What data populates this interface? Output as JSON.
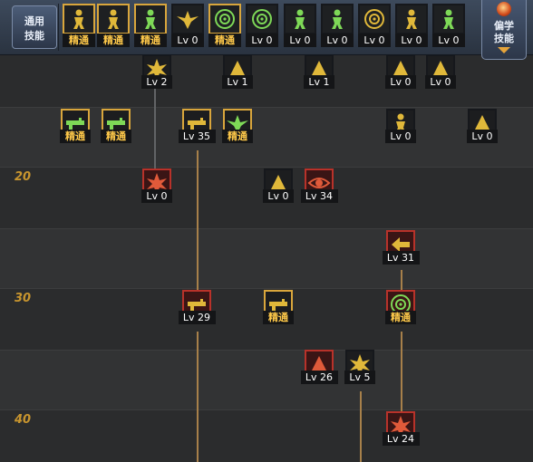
{
  "top_bar": {
    "common_tab": {
      "line1": "通用",
      "line2": "技能"
    },
    "side_tab": {
      "line1": "偏学",
      "line2": "技能"
    },
    "skills": [
      {
        "label": "精通",
        "mastered": true,
        "icon": "sitting-figure-icon",
        "color": "#e0b83a"
      },
      {
        "label": "精通",
        "mastered": true,
        "icon": "crouching-figure-icon",
        "color": "#e0b83a"
      },
      {
        "label": "精通",
        "mastered": true,
        "icon": "running-figure-icon",
        "color": "#7ed957"
      },
      {
        "label": "Lv 0",
        "mastered": false,
        "icon": "winged-emblem-icon",
        "color": "#e0b83a"
      },
      {
        "label": "精通",
        "mastered": true,
        "icon": "crosshair-target-icon",
        "color": "#7ed957"
      },
      {
        "label": "Lv 0",
        "mastered": false,
        "icon": "crosshair-target-icon",
        "color": "#7ed957"
      },
      {
        "label": "Lv 0",
        "mastered": false,
        "icon": "soldier-bust-icon",
        "color": "#7ed957"
      },
      {
        "label": "Lv 0",
        "mastered": false,
        "icon": "soldier-bust-icon",
        "color": "#7ed957"
      },
      {
        "label": "Lv 0",
        "mastered": false,
        "icon": "concentric-rings-icon",
        "color": "#e0b83a"
      },
      {
        "label": "Lv 0",
        "mastered": false,
        "icon": "muscle-figure-icon",
        "color": "#e0b83a"
      },
      {
        "label": "Lv 0",
        "mastered": false,
        "icon": "standing-figure-icon",
        "color": "#7ed957"
      }
    ]
  },
  "level_labels": [
    "20",
    "30",
    "40"
  ],
  "tree": [
    {
      "label": "Lv 2",
      "mastered": false,
      "frame": "dark",
      "icon": "fire-burst-icon",
      "color": "#e0b83a"
    },
    {
      "label": "Lv 1",
      "mastered": false,
      "frame": "dark",
      "icon": "flag-icon",
      "color": "#e0b83a"
    },
    {
      "label": "Lv 1",
      "mastered": false,
      "frame": "dark",
      "icon": "lightning-icon",
      "color": "#e0b83a"
    },
    {
      "label": "Lv 0",
      "mastered": false,
      "frame": "dark",
      "icon": "treasure-box-icon",
      "color": "#e0b83a"
    },
    {
      "label": "Lv 0",
      "mastered": false,
      "frame": "dark",
      "icon": "trophy-icon",
      "color": "#e0b83a"
    },
    {
      "label": "精通",
      "mastered": true,
      "frame": "gold",
      "icon": "rifle-icon",
      "color": "#7ed957"
    },
    {
      "label": "精通",
      "mastered": true,
      "frame": "gold",
      "icon": "rifle-icon",
      "color": "#7ed957"
    },
    {
      "label": "Lv 35",
      "mastered": false,
      "frame": "gold",
      "icon": "heavy-gun-icon",
      "color": "#e0b83a"
    },
    {
      "label": "精通",
      "mastered": true,
      "frame": "gold",
      "icon": "jet-fighter-icon",
      "color": "#7ed957"
    },
    {
      "label": "Lv 0",
      "mastered": false,
      "frame": "dark",
      "icon": "leaping-figure-icon",
      "color": "#e0b83a"
    },
    {
      "label": "Lv 0",
      "mastered": false,
      "frame": "dark",
      "icon": "grenade-icon",
      "color": "#e0b83a"
    },
    {
      "label": "Lv 0",
      "mastered": false,
      "frame": "red",
      "icon": "flame-hand-icon",
      "color": "#e05a3a"
    },
    {
      "label": "Lv 0",
      "mastered": false,
      "frame": "dark",
      "icon": "energy-blast-icon",
      "color": "#e0b83a"
    },
    {
      "label": "Lv 34",
      "mastered": false,
      "frame": "red",
      "icon": "eye-icon",
      "color": "#e05a3a"
    },
    {
      "label": "Lv 31",
      "mastered": false,
      "frame": "red",
      "icon": "arrow-left-icon",
      "color": "#e0b83a"
    },
    {
      "label": "Lv 29",
      "mastered": false,
      "frame": "red",
      "icon": "cannon-icon",
      "color": "#e0b83a"
    },
    {
      "label": "精通",
      "mastered": true,
      "frame": "gold",
      "icon": "gun-plus-icon",
      "color": "#e0b83a"
    },
    {
      "label": "精通",
      "mastered": true,
      "frame": "red",
      "icon": "radar-icon",
      "color": "#7ed957"
    },
    {
      "label": "Lv 26",
      "mastered": false,
      "frame": "red",
      "icon": "swirl-icon",
      "color": "#e05a3a"
    },
    {
      "label": "Lv 5",
      "mastered": false,
      "frame": "dark",
      "icon": "explosion-icon",
      "color": "#e0b83a"
    },
    {
      "label": "Lv 24",
      "mastered": false,
      "frame": "red",
      "icon": "sunburst-icon",
      "color": "#e05a3a"
    }
  ]
}
